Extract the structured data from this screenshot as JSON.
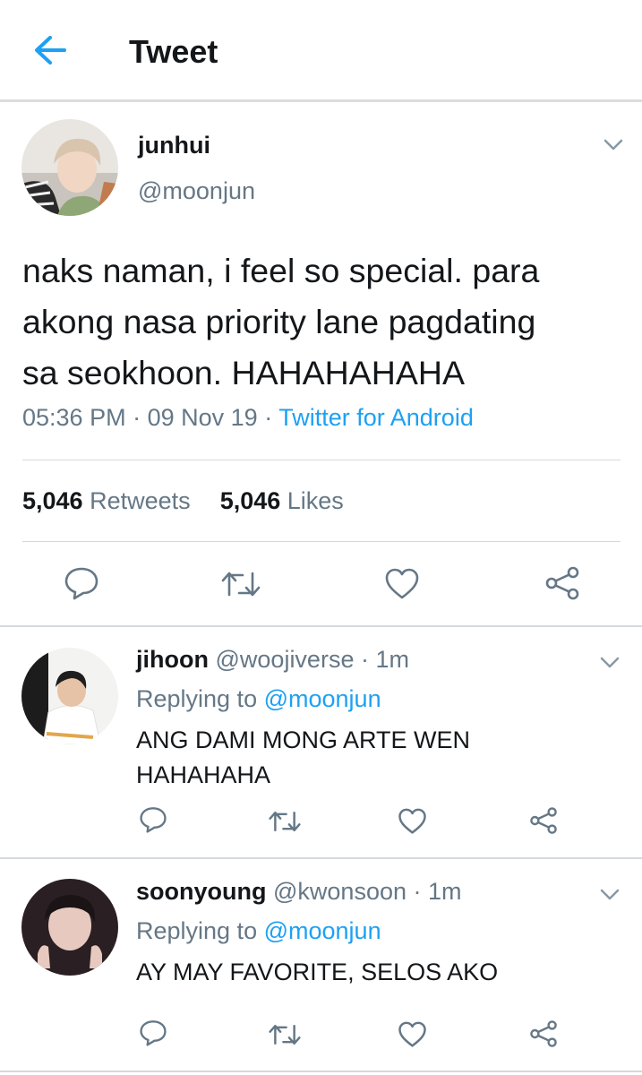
{
  "header": {
    "title": "Tweet",
    "back_icon": "back-arrow-icon",
    "accent": "#1da1f2"
  },
  "tweet": {
    "name": "junhui",
    "handle": "@moonjun",
    "text_lines": [
      "naks naman, i feel so special. para",
      "akong nasa priority lane pagdating",
      "sa seokhoon. HAHAHAHAHA"
    ],
    "time": "05:36 PM",
    "date": "09 Nov 19",
    "sep": "·",
    "client": "Twitter for Android",
    "retweets_count": "5,046",
    "retweets_label": "Retweets",
    "likes_count": "5,046",
    "likes_label": "Likes"
  },
  "replies": [
    {
      "name": "jihoon",
      "handle": "@woojiverse",
      "meta": "· 1m",
      "replying_prefix": "Replying to",
      "replying_handle": "@moonjun",
      "text_lines": [
        "ANG DAMI MONG ARTE WEN",
        "HAHAHAHA"
      ]
    },
    {
      "name": "soonyoung",
      "handle": "@kwonsoon",
      "meta": "· 1m",
      "replying_prefix": "Replying to",
      "replying_handle": "@moonjun",
      "text_lines": [
        "AY MAY FAVORITE, SELOS AKO"
      ]
    }
  ],
  "colors": {
    "text": "#14171a",
    "secondary": "#657786",
    "link": "#1da1f2",
    "divider": "#d4d9dd"
  },
  "icons": [
    "back-arrow-icon",
    "chevron-down-icon",
    "reply-icon",
    "retweet-icon",
    "like-icon",
    "share-icon"
  ]
}
